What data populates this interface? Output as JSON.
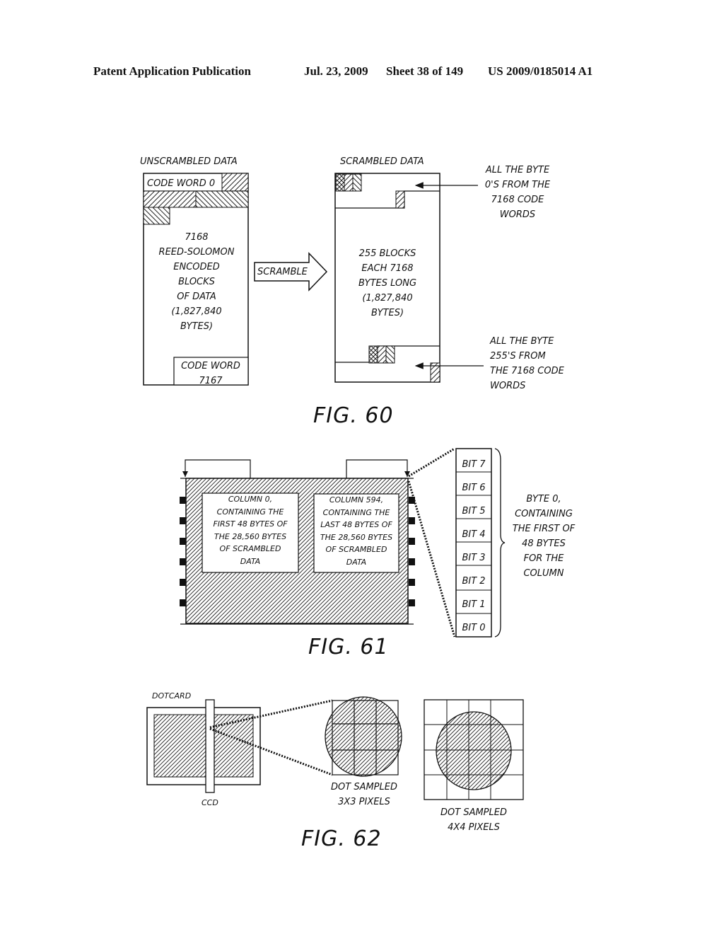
{
  "header": {
    "left": "Patent Application Publication",
    "date": "Jul. 23, 2009",
    "sheet": "Sheet 38 of 149",
    "pub_number": "US 2009/0185014 A1"
  },
  "fig60": {
    "caption": "FIG. 60",
    "unscrambled_title": "UNSCRAMBLED DATA",
    "code_word_first": "CODE WORD 0",
    "unscrambled_body": [
      "7168",
      "REED-SOLOMON",
      "ENCODED",
      "BLOCKS",
      "OF DATA",
      "(1,827,840",
      "BYTES)"
    ],
    "code_word_last": [
      "CODE WORD",
      "7167"
    ],
    "arrow_label": "SCRAMBLE",
    "scrambled_title": "SCRAMBLED DATA",
    "scrambled_body": [
      "255 BLOCKS",
      "EACH 7168",
      "BYTES LONG",
      "(1,827,840",
      "BYTES)"
    ],
    "note_top": [
      "ALL THE BYTE",
      "0'S FROM THE",
      "7168 CODE",
      "WORDS"
    ],
    "note_bottom": [
      "ALL THE BYTE",
      "255'S FROM",
      "THE 7168 CODE",
      "WORDS"
    ]
  },
  "fig61": {
    "caption": "FIG. 61",
    "column_first": [
      "COLUMN 0,",
      "CONTAINING THE",
      "FIRST 48 BYTES OF",
      "THE 28,560 BYTES",
      "OF SCRAMBLED",
      "DATA"
    ],
    "column_last": [
      "COLUMN 594,",
      "CONTAINING THE",
      "LAST 48 BYTES OF",
      "THE 28,560 BYTES",
      "OF SCRAMBLED",
      "DATA"
    ],
    "bits": [
      "BIT 7",
      "BIT 6",
      "BIT 5",
      "BIT 4",
      "BIT 3",
      "BIT 2",
      "BIT 1",
      "BIT 0"
    ],
    "byte_note": [
      "BYTE 0,",
      "CONTAINING",
      "THE FIRST OF",
      "48 BYTES",
      "FOR THE",
      "COLUMN"
    ]
  },
  "fig62": {
    "caption": "FIG. 62",
    "dotcard_label": "DOTCARD",
    "ccd_label": "CCD",
    "sample_3x3": [
      "DOT SAMPLED",
      "3X3 PIXELS"
    ],
    "sample_4x4": [
      "DOT SAMPLED",
      "4X4 PIXELS"
    ]
  }
}
